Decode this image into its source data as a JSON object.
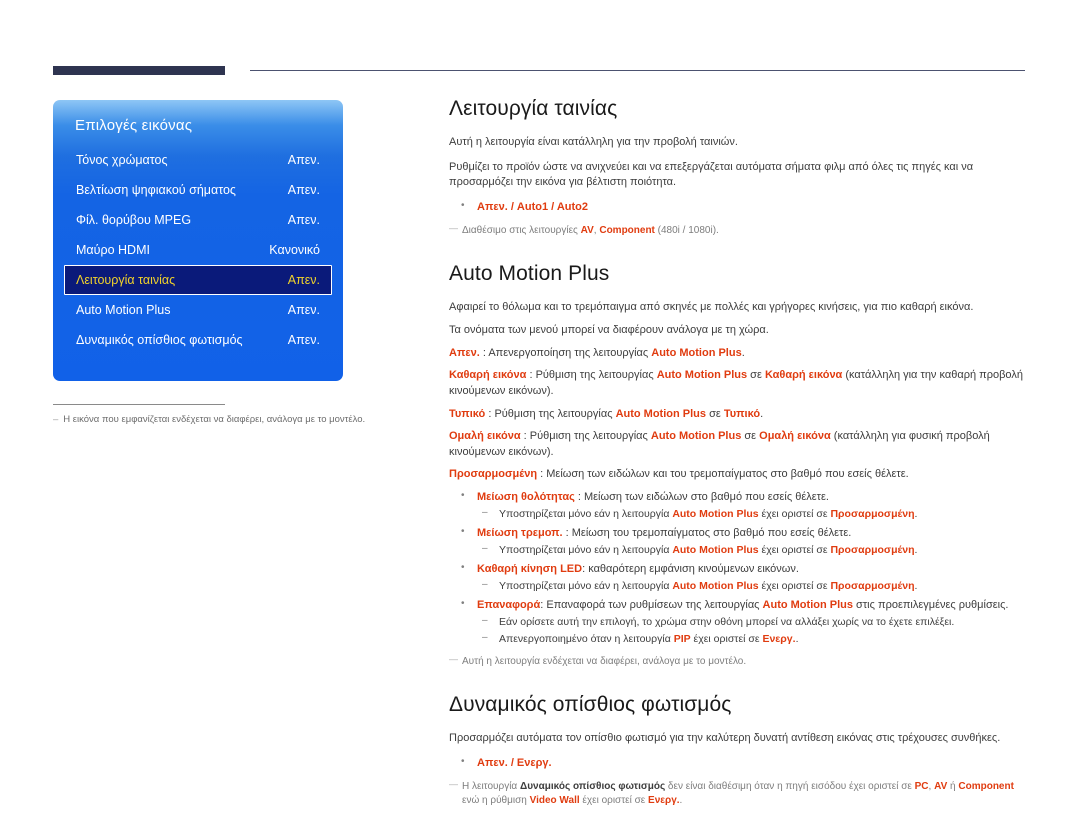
{
  "header": {
    "bar_label": "page-header-bar",
    "rule_label": "page-header-rule"
  },
  "osd": {
    "title": "Επιλογές εικόνας",
    "rows": [
      {
        "label": "Τόνος χρώματος",
        "value": "Απεν.",
        "selected": false
      },
      {
        "label": "Βελτίωση ψηφιακού σήματος",
        "value": "Απεν.",
        "selected": false
      },
      {
        "label": "Φίλ. θορύβου MPEG",
        "value": "Απεν.",
        "selected": false
      },
      {
        "label": "Μαύρο HDMI",
        "value": "Κανονικό",
        "selected": false
      },
      {
        "label": "Λειτουργία ταινίας",
        "value": "Απεν.",
        "selected": true
      },
      {
        "label": "Auto Motion Plus",
        "value": "Απεν.",
        "selected": false
      },
      {
        "label": "Δυναμικός οπίσθιος φωτισμός",
        "value": "Απεν.",
        "selected": false
      }
    ],
    "colors": {
      "panel_top": "#8ec6f5",
      "panel_main": "#1161e8",
      "selected_bg": "#0a1a7a",
      "selected_text": "#f2d22a",
      "text": "#ffffff"
    },
    "footnote": {
      "dash": "–",
      "text": "Η εικόνα που εμφανίζεται ενδέχεται να διαφέρει, ανάλογα με το μοντέλο."
    }
  },
  "sections": {
    "movie_mode": {
      "heading": "Λειτουργία ταινίας",
      "p1": "Αυτή η λειτουργία είναι κατάλληλη για την προβολή ταινιών.",
      "p2": "Ρυθμίζει το προϊόν ώστε να ανιχνεύει και να επεξεργάζεται αυτόματα σήματα φιλμ από όλες τις πηγές και να προσαρμόζει την εικόνα για βέλτιστη ποιότητα.",
      "bullet_options": "Απεν. / Auto1 / Auto2",
      "note_pre": "Διαθέσιμο στις λειτουργίες ",
      "note_av": "AV",
      "note_sep": ", ",
      "note_component": "Component",
      "note_post": " (480i / 1080i)."
    },
    "auto_motion_plus": {
      "heading": "Auto Motion Plus",
      "p1": "Αφαιρεί το θόλωμα και το τρεμόπαιγμα από σκηνές με πολλές και γρήγορες κινήσεις, για πιο καθαρή εικόνα.",
      "p2": "Τα ονόματα των μενού μπορεί να διαφέρουν ανάλογα με τη χώρα.",
      "defs": [
        {
          "term": "Απεν.",
          "sep": " : ",
          "body_1": "Απενεργοποίηση της λειτουργίας ",
          "em_1": "Auto Motion Plus",
          "body_2": ".",
          "em_2": "",
          "body_3": ""
        },
        {
          "term": "Καθαρή εικόνα",
          "sep": " : ",
          "body_1": "Ρύθμιση της λειτουργίας ",
          "em_1": "Auto Motion Plus",
          "body_2": " σε ",
          "em_2": "Καθαρή εικόνα",
          "body_3": " (κατάλληλη για την καθαρή προβολή κινούμενων εικόνων)."
        },
        {
          "term": "Τυπικό",
          "sep": " : ",
          "body_1": "Ρύθμιση της λειτουργίας ",
          "em_1": "Auto Motion Plus",
          "body_2": " σε ",
          "em_2": "Τυπικό",
          "body_3": "."
        },
        {
          "term": "Ομαλή εικόνα",
          "sep": " : ",
          "body_1": "Ρύθμιση της λειτουργίας ",
          "em_1": "Auto Motion Plus",
          "body_2": " σε ",
          "em_2": "Ομαλή εικόνα",
          "body_3": " (κατάλληλη για φυσική προβολή κινούμενων εικόνων)."
        },
        {
          "term": "Προσαρμοσμένη",
          "sep": " : ",
          "body_1": "Μείωση των ειδώλων και του τρεμοπαίγματος στο βαθμό που εσείς θέλετε.",
          "em_1": "",
          "body_2": "",
          "em_2": "",
          "body_3": ""
        }
      ],
      "sub_items": [
        {
          "term": "Μείωση θολότητας",
          "sep": " : ",
          "desc": "Μείωση των ειδώλων στο βαθμό που εσείς θέλετε.",
          "sub_pre": "Υποστηρίζεται μόνο εάν η λειτουργία ",
          "sub_em1": "Auto Motion Plus",
          "sub_mid": " έχει οριστεί σε ",
          "sub_em2": "Προσαρμοσμένη",
          "sub_post": "."
        },
        {
          "term": "Μείωση τρεμοπ.",
          "sep": " : ",
          "desc": "Μείωση του τρεμοπαίγματος στο βαθμό που εσείς θέλετε.",
          "sub_pre": "Υποστηρίζεται μόνο εάν η λειτουργία ",
          "sub_em1": "Auto Motion Plus",
          "sub_mid": " έχει οριστεί σε ",
          "sub_em2": "Προσαρμοσμένη",
          "sub_post": "."
        },
        {
          "term": "Καθαρή κίνηση LED",
          "sep": ": ",
          "desc": "καθαρότερη εμφάνιση κινούμενων εικόνων.",
          "sub_pre": "Υποστηρίζεται μόνο εάν η λειτουργία ",
          "sub_em1": "Auto Motion Plus",
          "sub_mid": " έχει οριστεί σε ",
          "sub_em2": "Προσαρμοσμένη",
          "sub_post": "."
        }
      ],
      "reset_item": {
        "term": "Επαναφορά",
        "sep": ": ",
        "body_1": "Επαναφορά των ρυθμίσεων της λειτουργίας ",
        "em_1": "Auto Motion Plus",
        "body_2": " στις προεπιλεγμένες ρυθμίσεις.",
        "subs": [
          {
            "pre": "Εάν ορίσετε αυτή την επιλογή, το χρώμα στην οθόνη μπορεί να αλλάξει χωρίς να το έχετε επιλέξει.",
            "em1": "",
            "mid": "",
            "em2": "",
            "post": ""
          },
          {
            "pre": "Απενεργοποιημένο όταν η λειτουργία ",
            "em1": "PIP",
            "mid": " έχει οριστεί σε ",
            "em2": "Ενεργ.",
            "post": "."
          }
        ]
      },
      "note": "Αυτή η λειτουργία ενδέχεται να διαφέρει, ανάλογα με το μοντέλο."
    },
    "dynamic_backlight": {
      "heading": "Δυναμικός οπίσθιος φωτισμός",
      "p1": "Προσαρμόζει αυτόματα τον οπίσθιο φωτισμό για την καλύτερη δυνατή αντίθεση εικόνας στις τρέχουσες συνθήκες.",
      "bullet_options": "Απεν. / Ενεργ.",
      "note_pre": "Η λειτουργία ",
      "note_em1": "Δυναμικός οπίσθιος φωτισμός",
      "note_mid1": " δεν είναι διαθέσιμη όταν η πηγή εισόδου έχει οριστεί σε ",
      "note_em2": "PC",
      "note_sep1": ", ",
      "note_em3": "AV",
      "note_mid2": " ή ",
      "note_em4": "Component",
      "note_mid3": " ενώ η ρύθμιση ",
      "note_em5": "Video Wall",
      "note_mid4": " έχει οριστεί σε ",
      "note_em6": "Ενεργ.",
      "note_post": "."
    }
  },
  "theme": {
    "accent_red": "#e03c10",
    "header_navy": "#2e3450",
    "body_text": "#3d3d3d",
    "note_gray": "#7d7d7d"
  }
}
